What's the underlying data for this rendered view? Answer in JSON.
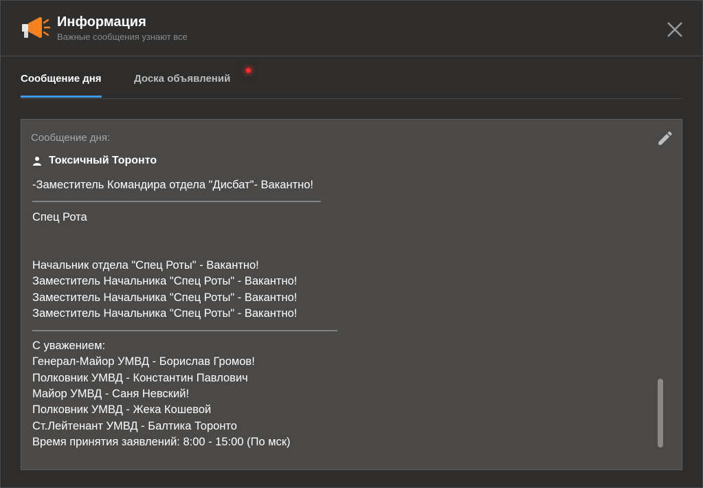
{
  "header": {
    "icon": "megaphone-icon",
    "title": "Информация",
    "subtitle": "Важные сообщения узнают все",
    "close_icon": "close-icon"
  },
  "tabs": [
    {
      "label": "Сообщение дня",
      "active": true
    },
    {
      "label": "Доска объявлений",
      "active": false,
      "notification": true
    }
  ],
  "panel": {
    "label": "Сообщение дня:",
    "author": "Токсичный Торонто",
    "lines": [
      "-Заместитель Командира отдела \"Дисбат\"- Вакантно!",
      "———————————————————————————————————",
      "Спец Рота",
      "",
      "",
      "Начальник отдела \"Спец Роты\" - Вакантно!",
      "Заместитель Начальника \"Спец Роты\" - Вакантно!",
      "Заместитель Начальника \"Спец Роты\" - Вакантно!",
      "Заместитель Начальника \"Спец Роты\" - Вакантно!",
      "—————————————————————————————————————",
      "С уважением:",
      "Генерал-Майор УМВД - Борислав Громов!",
      "Полковник УМВД - Константин Павлович",
      "Майор УМВД - Саня Невский!",
      "Полковник УМВД - Жека Кошевой",
      "Ст.Лейтенант УМВД - Балтика Торонто",
      "Время принятия заявлений: 8:00 - 15:00 (По мск)"
    ]
  },
  "colors": {
    "accent": "#3d9be9",
    "notification": "#ff2a2a",
    "megaphone_orange": "#f5821f"
  }
}
